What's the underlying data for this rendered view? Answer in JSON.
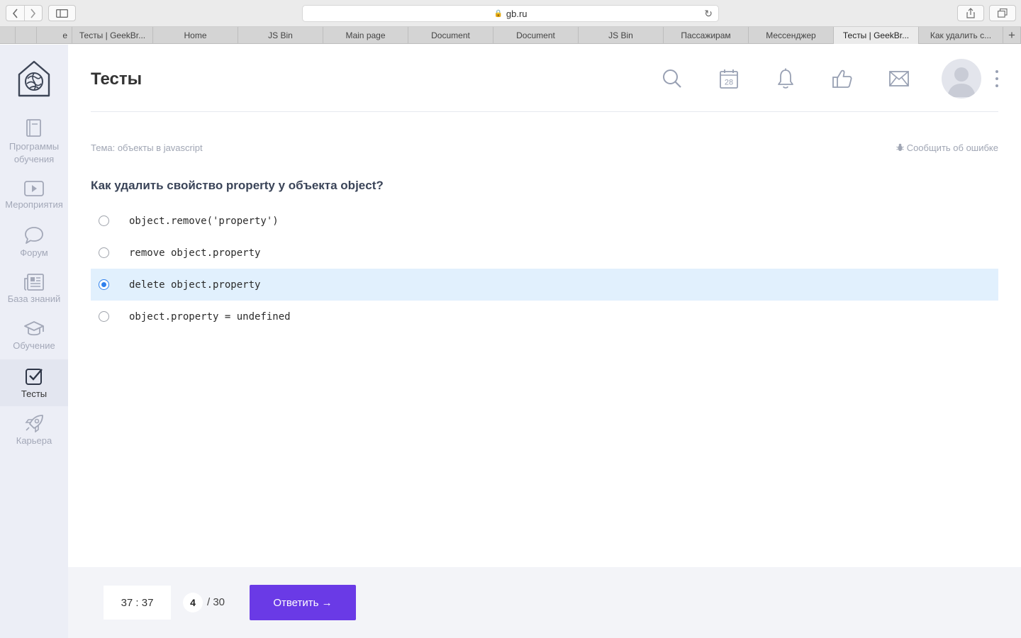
{
  "browser": {
    "url": "gb.ru",
    "tabs": [
      {
        "label": "",
        "active": false
      },
      {
        "label": "",
        "active": false
      },
      {
        "label": "e",
        "active": false
      },
      {
        "label": "Тесты | GeekBr...",
        "active": false
      },
      {
        "label": "Home",
        "active": false
      },
      {
        "label": "JS Bin",
        "active": false
      },
      {
        "label": "Main page",
        "active": false
      },
      {
        "label": "Document",
        "active": false
      },
      {
        "label": "Document",
        "active": false
      },
      {
        "label": "JS Bin",
        "active": false
      },
      {
        "label": "Пассажирам",
        "active": false
      },
      {
        "label": "Мессенджер",
        "active": false
      },
      {
        "label": "Тесты | GeekBr...",
        "active": true
      },
      {
        "label": "Как удалить с...",
        "active": false
      }
    ],
    "new_tab": "+"
  },
  "sidebar": {
    "items": [
      {
        "label": "Программы обучения",
        "icon": "book-icon"
      },
      {
        "label": "Мероприятия",
        "icon": "video-icon"
      },
      {
        "label": "Форум",
        "icon": "chat-icon"
      },
      {
        "label": "База знаний",
        "icon": "newspaper-icon"
      },
      {
        "label": "Обучение",
        "icon": "graduation-cap-icon"
      },
      {
        "label": "Тесты",
        "icon": "checkbox-icon",
        "active": true
      },
      {
        "label": "Карьера",
        "icon": "rocket-icon"
      }
    ]
  },
  "header": {
    "title": "Тесты",
    "calendar_day": "28"
  },
  "test": {
    "topic": "Тема: объекты в javascript",
    "report_error": "Сообщить об ошибке",
    "question": "Как удалить свойство property у объекта object?",
    "answers": [
      {
        "text": "object.remove('property')",
        "selected": false
      },
      {
        "text": "remove object.property",
        "selected": false
      },
      {
        "text": "delete object.property",
        "selected": true
      },
      {
        "text": "object.property = undefined",
        "selected": false
      }
    ]
  },
  "footer": {
    "timer": "37 : 37",
    "current_question": "4",
    "total_questions": "/ 30",
    "submit_label": "Ответить →"
  },
  "colors": {
    "accent": "#6a3ae6",
    "selected_bg": "#e1f0fd",
    "radio_selected": "#2f80ed"
  }
}
